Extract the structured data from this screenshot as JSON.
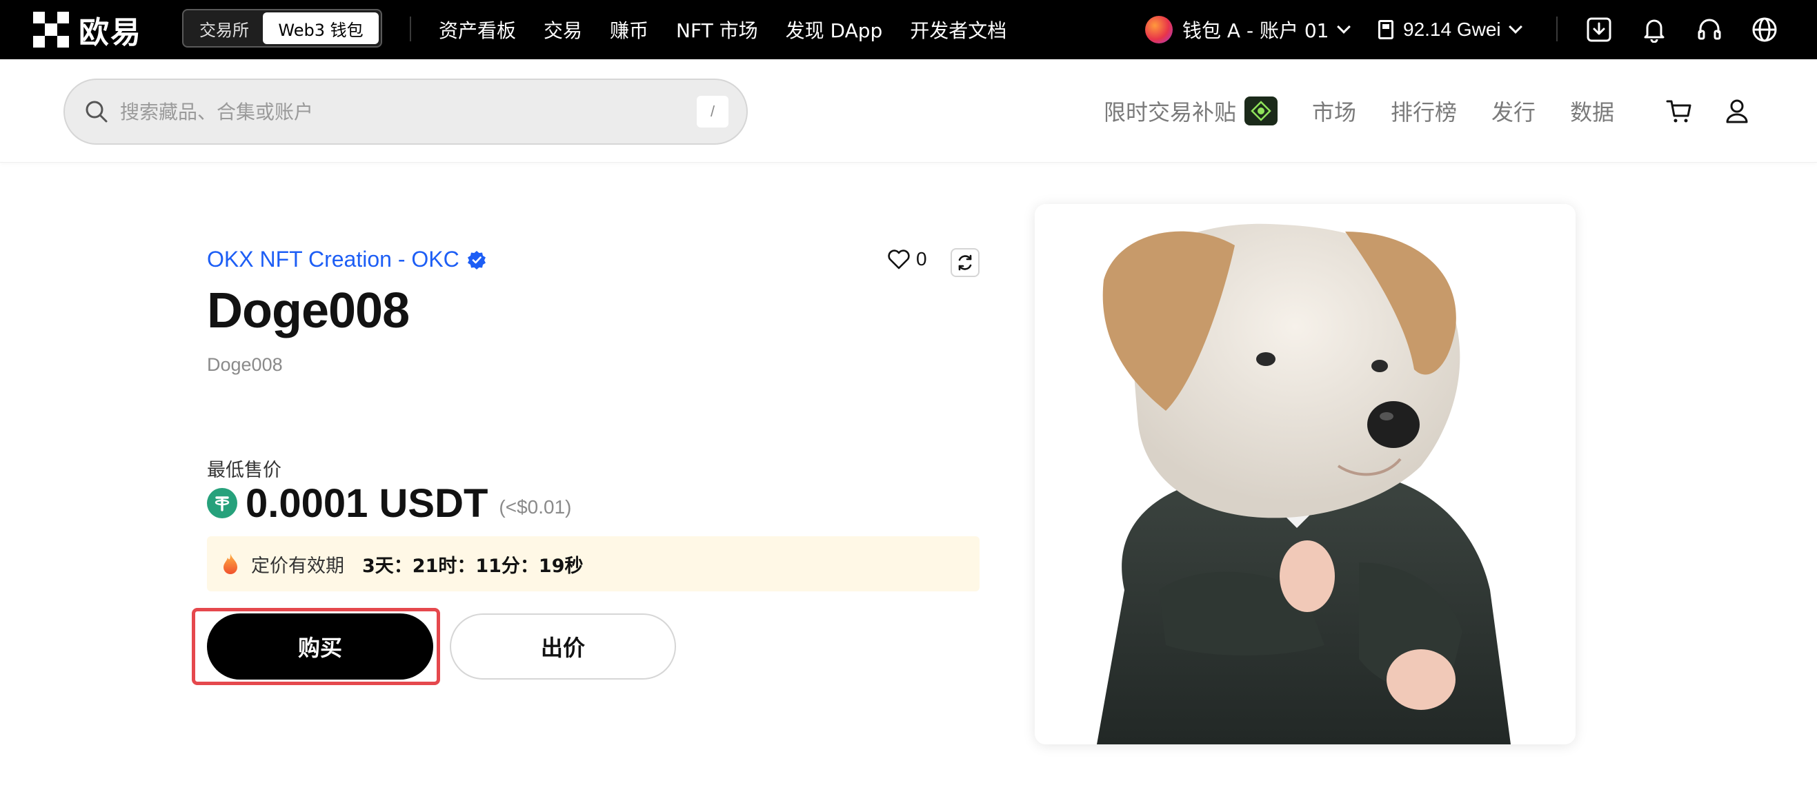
{
  "topbar": {
    "logo_text": "欧易",
    "mode_tabs": [
      {
        "label": "交易所",
        "active": false
      },
      {
        "label": "Web3 钱包",
        "active": true
      }
    ],
    "nav": [
      "资产看板",
      "交易",
      "赚币",
      "NFT 市场",
      "发现 DApp",
      "开发者文档"
    ],
    "wallet_label": "钱包 A - 账户 01",
    "gas_label": "92.14 Gwei",
    "icons": [
      "download-icon",
      "bell-icon",
      "headset-icon",
      "globe-icon"
    ]
  },
  "navbar2": {
    "search_placeholder": "搜索藏品、合集或账户",
    "search_shortcut": "/",
    "links": [
      "限时交易补贴",
      "市场",
      "排行榜",
      "发行",
      "数据"
    ],
    "icons": [
      "cart-icon",
      "user-icon"
    ]
  },
  "nft": {
    "collection": "OKX NFT Creation - OKC",
    "likes": "0",
    "title": "Doge008",
    "subtitle": "Doge008",
    "price_label": "最低售价",
    "price_value": "0.0001 USDT",
    "price_fiat": "(<$0.01)",
    "expiry_label": "定价有效期",
    "expiry_time": "3天：21时：11分：19秒",
    "buy_label": "购买",
    "offer_label": "出价"
  },
  "colors": {
    "accent_link": "#1d5ef5",
    "highlight_border": "#e5484d",
    "usdt": "#26a17b",
    "banner_bg": "#fff8e6"
  }
}
